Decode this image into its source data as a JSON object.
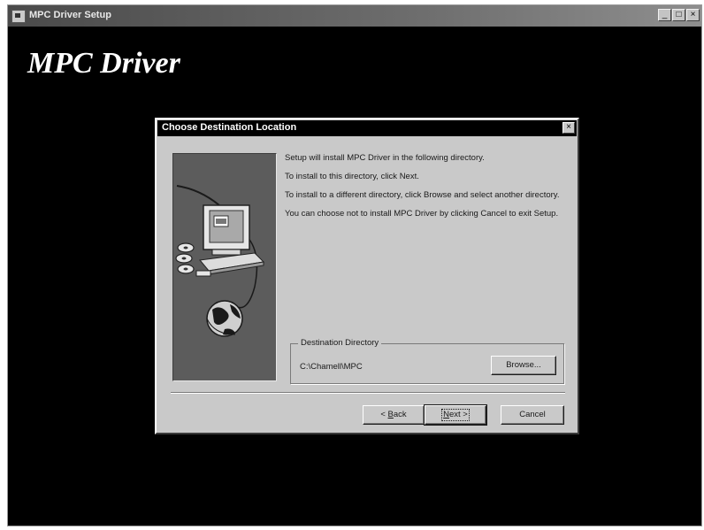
{
  "window": {
    "title": "MPC Driver Setup",
    "controls": {
      "minimize": "_",
      "maximize": "□",
      "close": "×"
    }
  },
  "banner": {
    "title": "MPC Driver"
  },
  "dialog": {
    "title": "Choose Destination Location",
    "close": "×",
    "messages": [
      "Setup will install MPC Driver in the following directory.",
      "To install to this directory, click Next.",
      "To install to a different directory, click Browse and select another directory.",
      "You can choose not to install MPC Driver by clicking Cancel to exit Setup."
    ],
    "destination": {
      "label": "Destination Directory",
      "path": "C:\\Chamell\\MPC",
      "browse_label": "Browse..."
    },
    "buttons": {
      "back_prefix": "< ",
      "back_key": "B",
      "back_rest": "ack",
      "next_key": "N",
      "next_rest": "ext >",
      "cancel": "Cancel"
    }
  },
  "icons": {
    "app": "setup-app-icon",
    "illustration": [
      "computer-monitor-icon",
      "disks-icon",
      "globe-icon"
    ]
  },
  "colors": {
    "desktop": "#000000",
    "dialog_face": "#c9c9c9",
    "illustration_bg": "#5c5c5c",
    "title_bar": "#000000"
  }
}
